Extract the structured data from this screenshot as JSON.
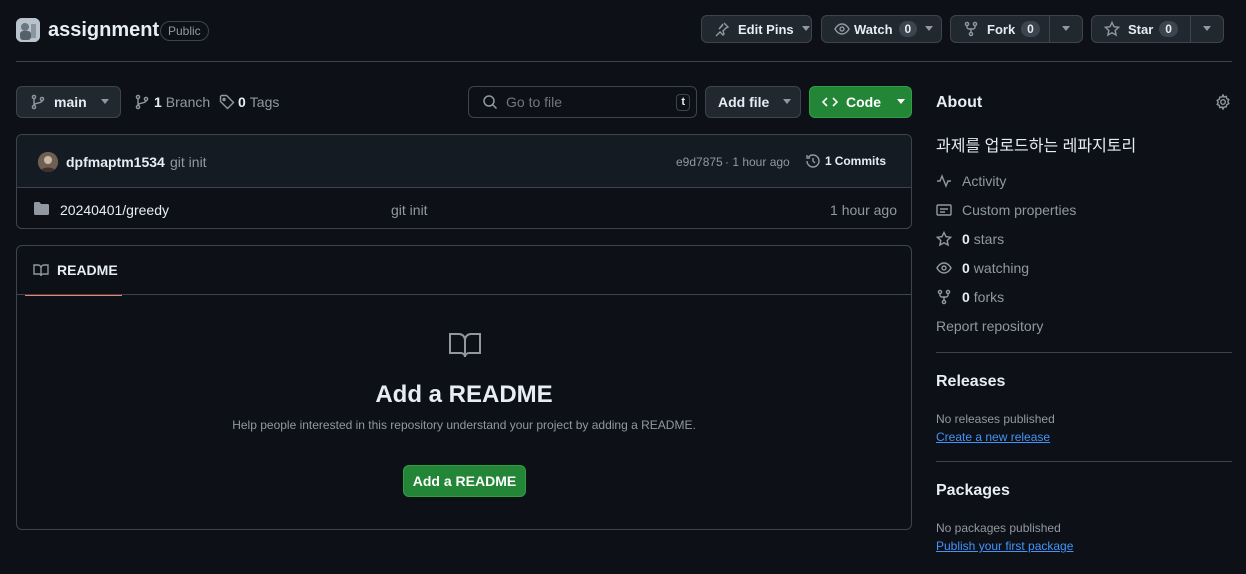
{
  "repo": {
    "name": "assignment",
    "visibility": "Public"
  },
  "actions": {
    "edit_pins": "Edit Pins",
    "watch": "Watch",
    "watch_count": "0",
    "fork": "Fork",
    "fork_count": "0",
    "star": "Star",
    "star_count": "0"
  },
  "toolbar": {
    "branch": "main",
    "branches_count": "1",
    "branches_label": "Branch",
    "tags_count": "0",
    "tags_label": "Tags",
    "search_placeholder": "Go to file",
    "search_key": "t",
    "add_file": "Add file",
    "code": "Code"
  },
  "commit": {
    "author": "dpfmaptm1534",
    "message": "git init",
    "hash": "e9d7875",
    "time": "· 1 hour ago",
    "commits_count": "1",
    "commits_label": "Commits"
  },
  "files": [
    {
      "name": "20240401/greedy",
      "message": "git init",
      "time": "1 hour ago"
    }
  ],
  "readme": {
    "tab": "README",
    "heading": "Add a README",
    "description": "Help people interested in this repository understand your project by adding a README.",
    "button": "Add a README"
  },
  "about": {
    "title": "About",
    "description": "과제를 업로드하는 레파지토리",
    "activity": "Activity",
    "custom_properties": "Custom properties",
    "stars_count": "0",
    "stars_label": "stars",
    "watching_count": "0",
    "watching_label": "watching",
    "forks_count": "0",
    "forks_label": "forks",
    "report": "Report repository"
  },
  "releases": {
    "title": "Releases",
    "empty": "No releases published",
    "link": "Create a new release"
  },
  "packages": {
    "title": "Packages",
    "empty": "No packages published",
    "link": "Publish your first package"
  }
}
